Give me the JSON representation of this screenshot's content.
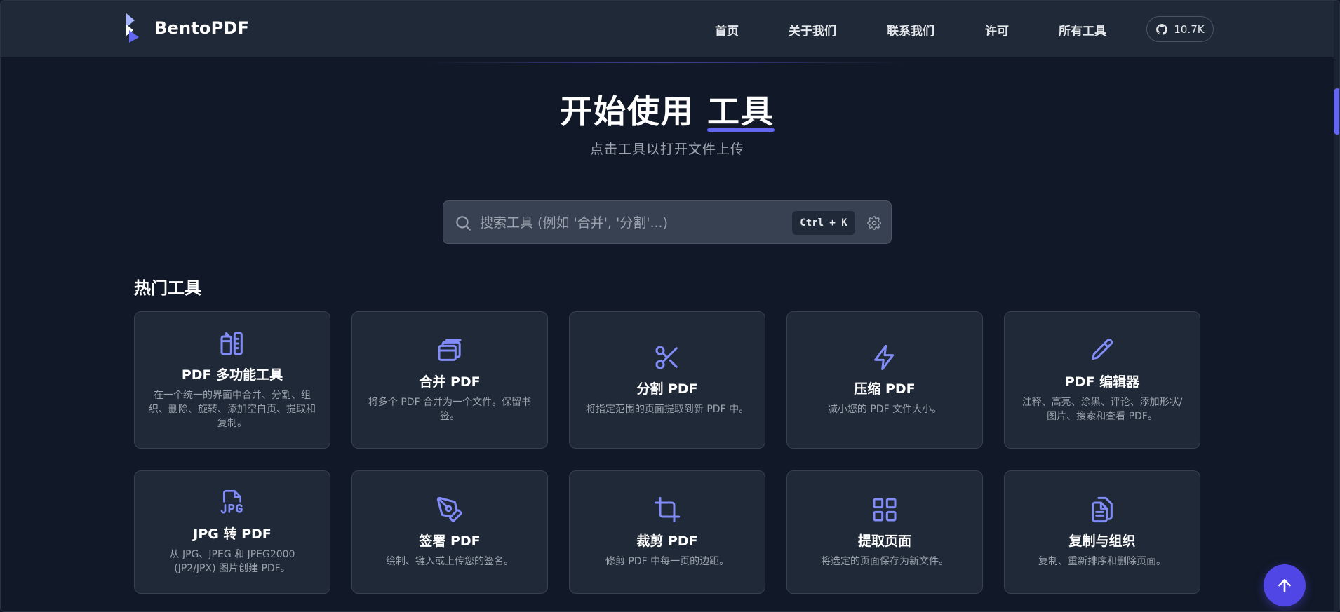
{
  "header": {
    "brand_name": "BentoPDF",
    "nav": [
      {
        "label": "首页"
      },
      {
        "label": "关于我们"
      },
      {
        "label": "联系我们"
      },
      {
        "label": "许可"
      },
      {
        "label": "所有工具"
      }
    ],
    "github": {
      "icon": "github-icon",
      "stars": "10.7K"
    }
  },
  "hero": {
    "title_prefix": "开始使用",
    "title_highlight": "工具",
    "subtitle": "点击工具以打开文件上传"
  },
  "search": {
    "placeholder": "搜索工具 (例如 '合并', '分割'...)",
    "value": "",
    "shortcut": "Ctrl + K"
  },
  "section": {
    "title": "热门工具"
  },
  "tools": [
    {
      "icon": "pdf-multitool-icon",
      "title": "PDF 多功能工具",
      "description": "在一个统一的界面中合并、分割、组织、删除、旋转、添加空白页、提取和复制。"
    },
    {
      "icon": "merge-icon",
      "title": "合并 PDF",
      "description": "将多个 PDF 合并为一个文件。保留书签。"
    },
    {
      "icon": "scissors-icon",
      "title": "分割 PDF",
      "description": "将指定范围的页面提取到新 PDF 中。"
    },
    {
      "icon": "lightning-icon",
      "title": "压缩 PDF",
      "description": "减小您的 PDF 文件大小。"
    },
    {
      "icon": "pencil-icon",
      "title": "PDF 编辑器",
      "description": "注释、高亮、涂黑、评论、添加形状/图片、搜索和查看 PDF。"
    },
    {
      "icon": "jpg-file-icon",
      "title": "JPG 转 PDF",
      "description": "从 JPG、JPEG 和 JPEG2000 (JP2/JPX) 图片创建 PDF。"
    },
    {
      "icon": "pen-nib-icon",
      "title": "签署 PDF",
      "description": "绘制、键入或上传您的签名。"
    },
    {
      "icon": "crop-icon",
      "title": "裁剪 PDF",
      "description": "修剪 PDF 中每一页的边距。"
    },
    {
      "icon": "grid-icon",
      "title": "提取页面",
      "description": "将选定的页面保存为新文件。"
    },
    {
      "icon": "copy-files-icon",
      "title": "复制与组织",
      "description": "复制、重新排序和删除页面。"
    }
  ],
  "colors": {
    "background": "#111827",
    "header": "#1f2937",
    "card": "#1f2937",
    "accent": "#6366f1",
    "icon": "#818cf8"
  }
}
